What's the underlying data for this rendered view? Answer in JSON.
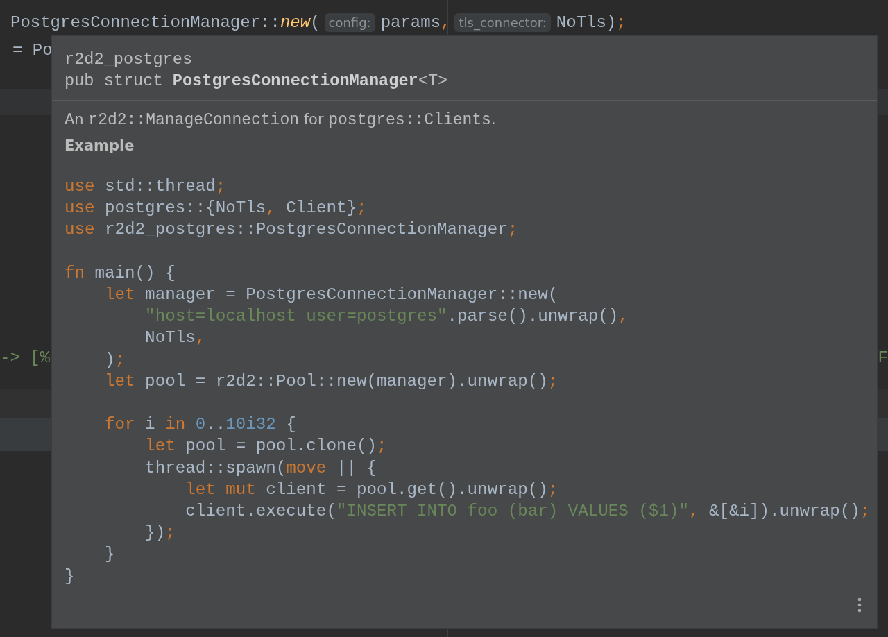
{
  "editor": {
    "lines": [
      {
        "segments": [
          {
            "kind": "code",
            "tokens": [
              {
                "text": "PostgresConnectionManager::",
                "kind": "plain"
              },
              {
                "text": "new",
                "kind": "function"
              },
              {
                "text": "(",
                "kind": "plain"
              }
            ]
          },
          {
            "kind": "hint",
            "text": "config:"
          },
          {
            "kind": "code",
            "tokens": [
              {
                "text": "params",
                "kind": "plain"
              },
              {
                "text": ",",
                "kind": "punct"
              }
            ]
          },
          {
            "kind": "hint",
            "text": "tls_connector:"
          },
          {
            "kind": "code",
            "tokens": [
              {
                "text": "NoTls)",
                "kind": "plain"
              },
              {
                "text": ";",
                "kind": "punct"
              }
            ]
          }
        ]
      },
      {
        "segments": [
          {
            "kind": "code",
            "tokens": [
              {
                "text": "= Po",
                "kind": "plain"
              }
            ]
          }
        ]
      },
      {
        "segments": [
          {
            "kind": "code",
            "tokens": [
              {
                "text": "-> [%",
                "kind": "string"
              }
            ]
          },
          {
            "kind": "code",
            "tokens": [
              {
                "text": "F",
                "kind": "string"
              }
            ]
          }
        ]
      }
    ]
  },
  "popup": {
    "crate": "r2d2_postgres",
    "signature": "pub struct **PostgresConnectionManager**<T>",
    "description": [
      {
        "text": "An ",
        "kind": "text"
      },
      {
        "text": "r2d2::ManageConnection",
        "kind": "code"
      },
      {
        "text": " for ",
        "kind": "text"
      },
      {
        "text": "postgres::Clients",
        "kind": "code"
      },
      {
        "text": ".",
        "kind": "text"
      }
    ],
    "heading": "Example",
    "code_blocks": [
      [
        [
          {
            "text": "use",
            "kind": "keyword"
          },
          {
            "text": " std::thread",
            "kind": "plain"
          },
          {
            "text": ";",
            "kind": "punct"
          }
        ],
        [
          {
            "text": "use",
            "kind": "keyword"
          },
          {
            "text": " postgres::{NoTls",
            "kind": "plain"
          },
          {
            "text": ",",
            "kind": "punct"
          },
          {
            "text": " Client}",
            "kind": "plain"
          },
          {
            "text": ";",
            "kind": "punct"
          }
        ],
        [
          {
            "text": "use",
            "kind": "keyword"
          },
          {
            "text": " r2d2_postgres::PostgresConnectionManager",
            "kind": "plain"
          },
          {
            "text": ";",
            "kind": "punct"
          }
        ]
      ],
      [
        [
          {
            "text": "fn",
            "kind": "keyword"
          },
          {
            "text": " main() {",
            "kind": "plain"
          }
        ],
        [
          {
            "text": "    let",
            "kind": "keyword"
          },
          {
            "text": " manager = PostgresConnectionManager::new(",
            "kind": "plain"
          }
        ],
        [
          {
            "text": "        \"host=localhost user=postgres\"",
            "kind": "string"
          },
          {
            "text": ".parse().unwrap()",
            "kind": "plain"
          },
          {
            "text": ",",
            "kind": "punct"
          }
        ],
        [
          {
            "text": "        NoTls",
            "kind": "plain"
          },
          {
            "text": ",",
            "kind": "punct"
          }
        ],
        [
          {
            "text": "    )",
            "kind": "plain"
          },
          {
            "text": ";",
            "kind": "punct"
          }
        ],
        [
          {
            "text": "    let",
            "kind": "keyword"
          },
          {
            "text": " pool = r2d2::Pool::new(manager).unwrap()",
            "kind": "plain"
          },
          {
            "text": ";",
            "kind": "punct"
          }
        ]
      ],
      [
        [
          {
            "text": "    for",
            "kind": "keyword"
          },
          {
            "text": " i ",
            "kind": "plain"
          },
          {
            "text": "in",
            "kind": "keyword"
          },
          {
            "text": " 0",
            "kind": "number"
          },
          {
            "text": "..",
            "kind": "plain"
          },
          {
            "text": "10i32",
            "kind": "number"
          },
          {
            "text": " {",
            "kind": "plain"
          }
        ],
        [
          {
            "text": "        let",
            "kind": "keyword"
          },
          {
            "text": " pool = pool.clone()",
            "kind": "plain"
          },
          {
            "text": ";",
            "kind": "punct"
          }
        ],
        [
          {
            "text": "        thread::spawn(",
            "kind": "plain"
          },
          {
            "text": "move",
            "kind": "keyword"
          },
          {
            "text": " || {",
            "kind": "plain"
          }
        ],
        [
          {
            "text": "            let mut",
            "kind": "keyword"
          },
          {
            "text": " client = pool.get().unwrap()",
            "kind": "plain"
          },
          {
            "text": ";",
            "kind": "punct"
          }
        ],
        [
          {
            "text": "            client.execute(",
            "kind": "plain"
          },
          {
            "text": "\"INSERT INTO foo (bar) VALUES ($1)\"",
            "kind": "string"
          },
          {
            "text": ",",
            "kind": "punct"
          },
          {
            "text": " &[&i]).unwrap()",
            "kind": "plain"
          },
          {
            "text": ";",
            "kind": "punct"
          }
        ],
        [
          {
            "text": "        })",
            "kind": "plain"
          },
          {
            "text": ";",
            "kind": "punct"
          }
        ],
        [
          {
            "text": "    }",
            "kind": "plain"
          }
        ],
        [
          {
            "text": "}",
            "kind": "plain"
          }
        ]
      ]
    ]
  }
}
